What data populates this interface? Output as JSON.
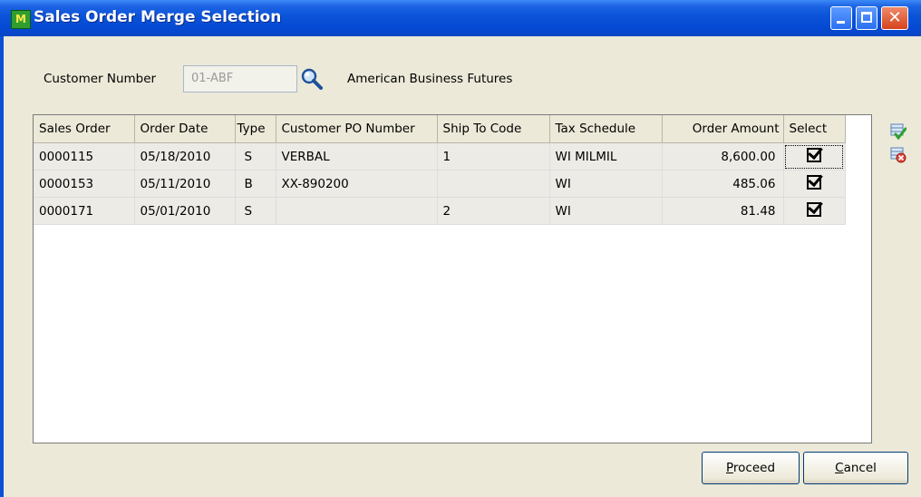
{
  "window": {
    "title": "Sales Order Merge Selection",
    "icon_glyph": "M",
    "close_glyph": "✕"
  },
  "form": {
    "customer_number_label": "Customer Number",
    "customer_number_value": "01-ABF",
    "customer_name": "American Business Futures"
  },
  "grid": {
    "headers": [
      "Sales Order",
      "Order Date",
      "Type",
      "Customer PO Number",
      "Ship To Code",
      "Tax Schedule",
      "Order Amount",
      "Select"
    ],
    "rows": [
      {
        "sales_order": "0000115",
        "order_date": "05/18/2010",
        "type": "S",
        "po": "VERBAL",
        "ship_to": "1",
        "tax": "WI MILMIL",
        "amount": "8,600.00",
        "selected": true
      },
      {
        "sales_order": "0000153",
        "order_date": "05/11/2010",
        "type": "B",
        "po": "XX-890200",
        "ship_to": "",
        "tax": "WI",
        "amount": "485.06",
        "selected": true
      },
      {
        "sales_order": "0000171",
        "order_date": "05/01/2010",
        "type": "S",
        "po": "",
        "ship_to": "2",
        "tax": "WI",
        "amount": "81.48",
        "selected": true
      }
    ]
  },
  "side_icons": [
    "select-all-icon",
    "deselect-all-icon"
  ],
  "buttons": {
    "proceed": {
      "accel": "P",
      "rest": "roceed"
    },
    "cancel": {
      "accel": "C",
      "rest": "ancel"
    }
  },
  "colors": {
    "titlebar": "#0a53d8",
    "dialog_bg": "#ece9d8",
    "row_bg": "#ecebe6"
  }
}
